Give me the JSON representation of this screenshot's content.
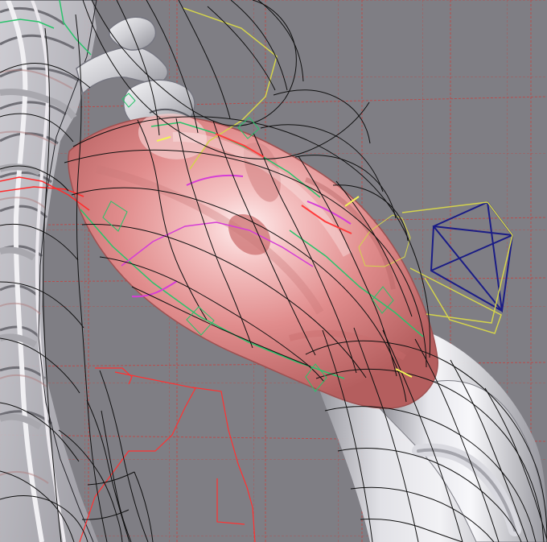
{
  "scene": {
    "view": "3d-viewport",
    "background_color": "#7f7e84",
    "grid_color": "#b34b4b",
    "wire_color": "#111111",
    "muscle_color": "#e58f8f",
    "bone_color": "#e8e8ea",
    "rig_colors": [
      "#33cc66",
      "#d0d040",
      "#cc33cc",
      "#ff2d2d",
      "#1a1a8a"
    ]
  }
}
